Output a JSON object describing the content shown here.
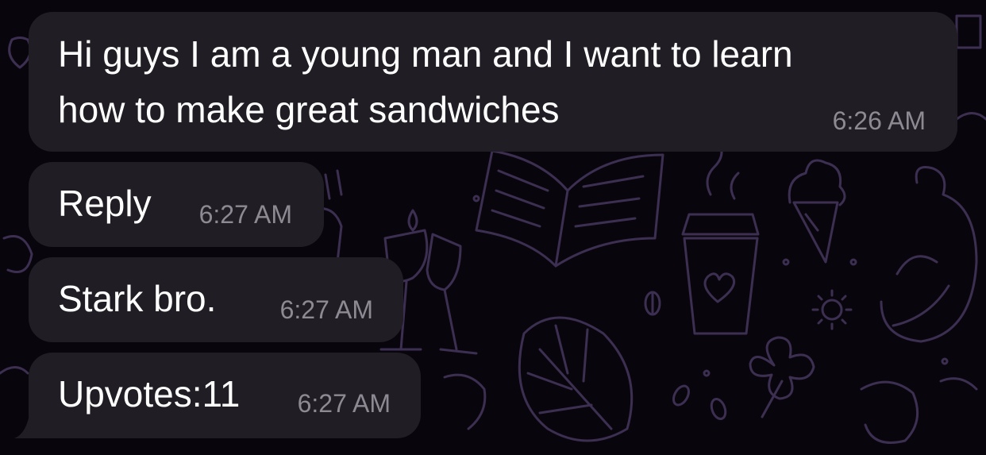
{
  "colors": {
    "background": "#08060c",
    "bubble": "#201d24",
    "text": "#ffffff",
    "timestamp": "#8e8a93",
    "wallpaper_pattern": "#3c2f52"
  },
  "wallpaper": {
    "icons": [
      "book-icon",
      "coffee-cup-icon",
      "ice-cream-icon",
      "duck-icon",
      "leaf-icon",
      "clover-icon",
      "sun-icon",
      "wine-glasses-icon",
      "coffee-bean-icon"
    ]
  },
  "messages": [
    {
      "text_line1": "Hi guys I am a young man and I want to learn",
      "text_line2": "how to make great sandwiches",
      "time": "6:26 AM"
    },
    {
      "text": "Reply",
      "time": "6:27 AM"
    },
    {
      "text": "Stark bro.",
      "time": "6:27 AM"
    },
    {
      "text": "Upvotes:11",
      "time": "6:27 AM"
    }
  ]
}
